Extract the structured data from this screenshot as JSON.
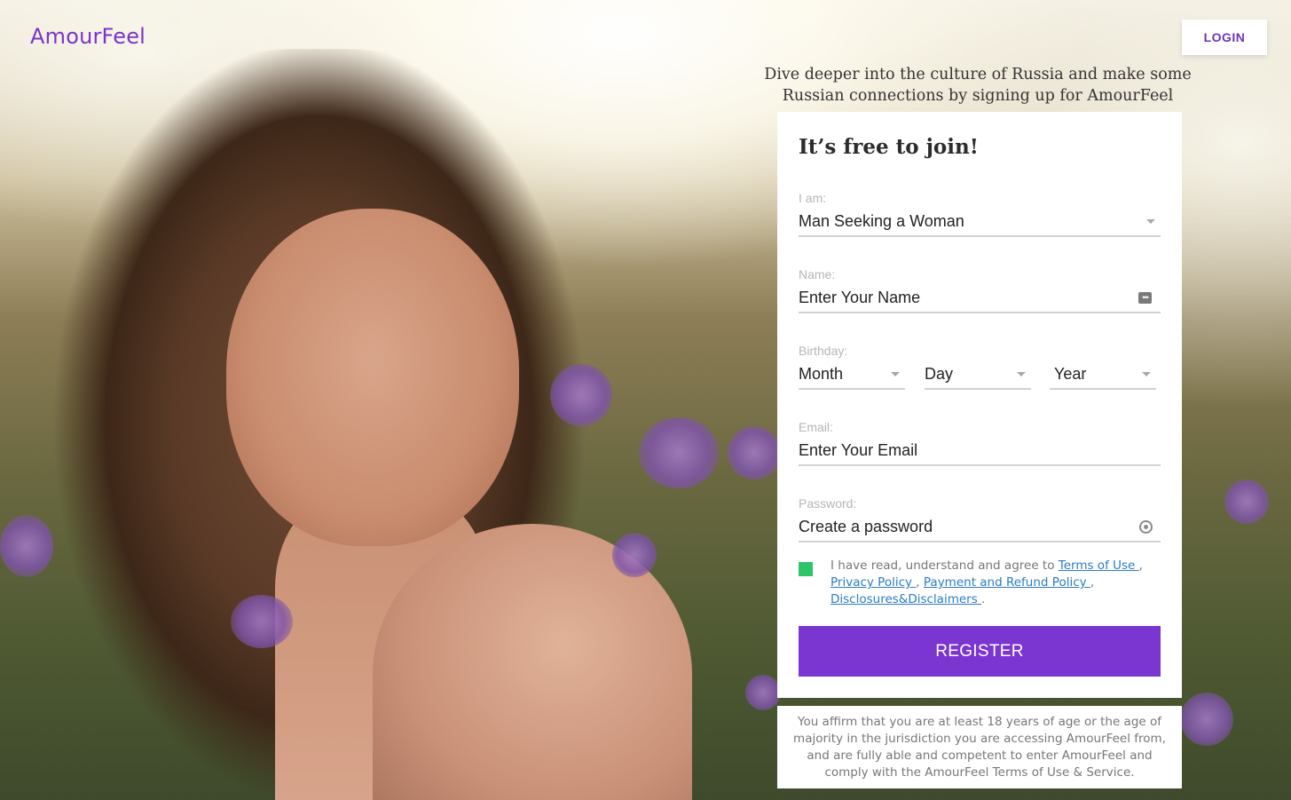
{
  "header": {
    "logo": "AmourFeel",
    "login_label": "LOGIN"
  },
  "tagline": "Dive deeper into the culture of Russia and make some Russian connections by signing up for AmourFeel",
  "form": {
    "title": "It’s free to join!",
    "i_am": {
      "label": "I am:",
      "value": "Man Seeking a Woman"
    },
    "name": {
      "label": "Name:",
      "placeholder": "Enter Your Name"
    },
    "birthday": {
      "label": "Birthday:",
      "month": "Month",
      "day": "Day",
      "year": "Year"
    },
    "email": {
      "label": "Email:",
      "placeholder": "Enter Your Email"
    },
    "password": {
      "label": "Password:",
      "placeholder": "Create a password"
    },
    "agree": {
      "checked": true,
      "text": "I have read, understand and agree to ",
      "terms": "Terms of Use ",
      "privacy": "Privacy Policy ",
      "payment": "Payment and Refund Policy ",
      "disclosures": "Disclosures&Disclaimers ",
      "sep": ",",
      "end": "."
    },
    "register_label": "REGISTER"
  },
  "disclaimer": "You affirm that you are at least 18 years of age or the age of majority in the jurisdiction you are accessing AmourFeel from, and are fully able and competent to enter AmourFeel and comply with the AmourFeel Terms of Use & Service.",
  "colors": {
    "brand": "#7b35d1",
    "checkbox": "#2ec46a",
    "link": "#2a7cc4"
  }
}
